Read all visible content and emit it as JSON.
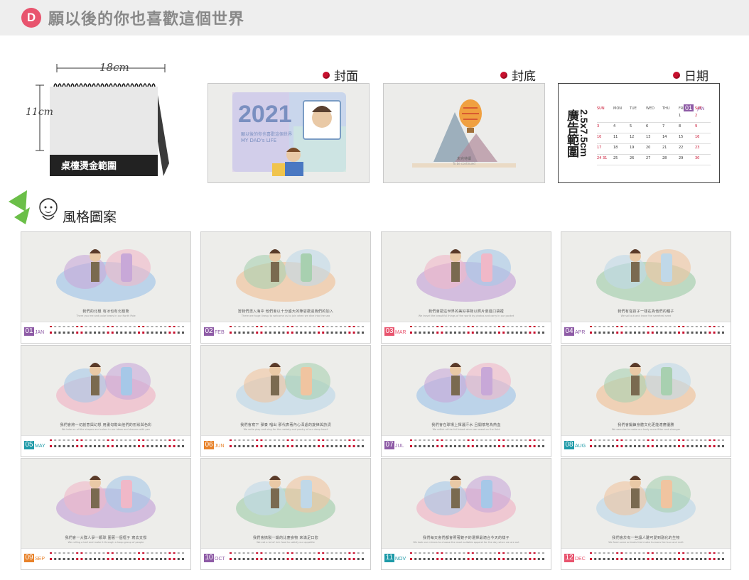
{
  "header": {
    "badge": "D",
    "title": "願以後的你也喜歡這個世界"
  },
  "desk": {
    "width_label": "18cm",
    "height_label": "11cm",
    "area_label": "桌檯燙金範圍"
  },
  "sections": {
    "cover": "封面",
    "back": "封底",
    "date": "日期",
    "style": "風格圖案"
  },
  "cover_art": {
    "year": "2021",
    "subtitle": "願以後的你也喜歡這個世界",
    "english": "MY DAD's LIFE"
  },
  "back_art": {
    "text1": "未完待續",
    "text2": "To be continued"
  },
  "calendar": {
    "month_num": "01",
    "month_name": "JAN",
    "ad_label": "廣告範圍",
    "ad_size": "2.5x7.5cm",
    "weekdays": [
      "SUN",
      "MON",
      "TUE",
      "WED",
      "THU",
      "FRI",
      "SAT"
    ],
    "weeks": [
      [
        "",
        "",
        "",
        "",
        "",
        "1",
        "2"
      ],
      [
        "3",
        "4",
        "5",
        "6",
        "7",
        "8",
        "9"
      ],
      [
        "10",
        "11",
        "12",
        "13",
        "14",
        "15",
        "16"
      ],
      [
        "17",
        "18",
        "19",
        "20",
        "21",
        "22",
        "23"
      ],
      [
        "24 31",
        "25",
        "26",
        "27",
        "28",
        "29",
        "30"
      ]
    ]
  },
  "months": [
    {
      "num": "01",
      "name": "JAN",
      "color": "#8e5ba6",
      "caption": "我們的北極 有冰也有北極熊",
      "sub": "There you me and polar bears in our North Pole"
    },
    {
      "num": "02",
      "name": "FEB",
      "color": "#8e5ba6",
      "caption": "當我們潛入海中 他們會以十分盛大的陣容歡迎我們的加入",
      "sub": "There are huge lineup to welcome us to join when we dive into the sea"
    },
    {
      "num": "03",
      "name": "MAR",
      "color": "#e8546e",
      "caption": "我們會把這世界的美好事物以照片裝進口袋裡",
      "sub": "We travel the beautiful things of the world by photos and carry in our pocket"
    },
    {
      "num": "04",
      "name": "APR",
      "color": "#8e5ba6",
      "caption": "我們有從孩子一樣在為他們的種子",
      "sub": "We sail out and leave the sweetest seed"
    },
    {
      "num": "05",
      "name": "MAY",
      "color": "#1e9aa8",
      "caption": "我們會將一切創意與幻想 用畫勾勒出他們的形狀與色彩",
      "sub": "We take on all the shapes and colors in our ideas and dreams with pen"
    },
    {
      "num": "06",
      "name": "JUN",
      "color": "#e8822a",
      "caption": "我們會寫下 彈奏 唱出 那代表著內心深處的旋律與詩詞",
      "sub": "We write play and sing for the melody and poetry of our deep heart"
    },
    {
      "num": "07",
      "name": "JUL",
      "color": "#8e5ba6",
      "caption": "我們會在球場上揮灑汗水 且開懷地為熱血",
      "sub": "We rollick at the full blood when we sweat on the field"
    },
    {
      "num": "08",
      "name": "AUG",
      "color": "#1e9aa8",
      "caption": "我們會鍛鍊身體文化更能適應優勝",
      "sub": "We exercise to make our body more fitter and stronger"
    },
    {
      "num": "09",
      "name": "SEP",
      "color": "#e8822a",
      "caption": "我們會一大群人爭一顆球 圍著一個框子 寫去支撐",
      "sub": "We rolling a ball and make it through a hoop group of people"
    },
    {
      "num": "10",
      "name": "OCT",
      "color": "#8e5ba6",
      "caption": "我們會搞製一鍋的比塵食物 來滿足口慾",
      "sub": "We eat a lot of rich food to satisfy our appetite"
    },
    {
      "num": "11",
      "name": "NOV",
      "color": "#1e9aa8",
      "caption": "我們每天會們都會照著鏡子的選擇最適合今天的樣子",
      "sub": "We look our mirrors to choose the most suitable apparel for the day when we are out"
    },
    {
      "num": "12",
      "name": "DEC",
      "color": "#e8546e",
      "caption": "我們會於有一些讓人難可愛到融化的生物",
      "sub": "We feed some animals that make humans feel sun and melt"
    }
  ]
}
